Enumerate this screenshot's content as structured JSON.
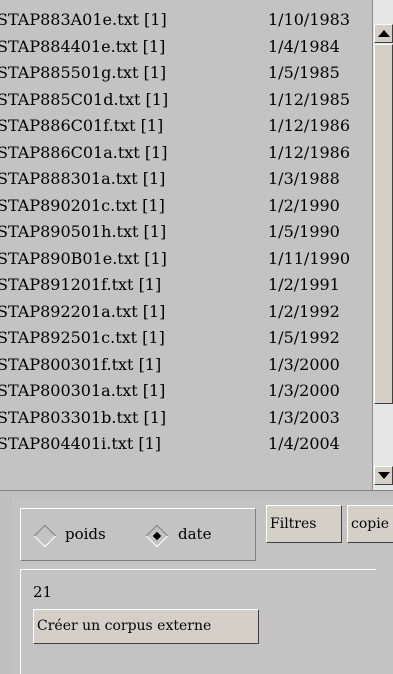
{
  "file_list": [
    {
      "name": "STAP883A01e.txt [1]",
      "date": "1/10/1983"
    },
    {
      "name": "STAP884401e.txt [1]",
      "date": "1/4/1984"
    },
    {
      "name": "STAP885501g.txt [1]",
      "date": "1/5/1985"
    },
    {
      "name": "STAP885C01d.txt [1]",
      "date": "1/12/1985"
    },
    {
      "name": "STAP886C01f.txt [1]",
      "date": "1/12/1986"
    },
    {
      "name": "STAP886C01a.txt [1]",
      "date": "1/12/1986"
    },
    {
      "name": "STAP888301a.txt [1]",
      "date": "1/3/1988"
    },
    {
      "name": "STAP890201c.txt [1]",
      "date": "1/2/1990"
    },
    {
      "name": "STAP890501h.txt [1]",
      "date": "1/5/1990"
    },
    {
      "name": "STAP890B01e.txt [1]",
      "date": "1/11/1990"
    },
    {
      "name": "STAP891201f.txt [1]",
      "date": "1/2/1991"
    },
    {
      "name": "STAP892201a.txt [1]",
      "date": "1/2/1992"
    },
    {
      "name": "STAP892501c.txt [1]",
      "date": "1/5/1992"
    },
    {
      "name": "STAP800301f.txt [1]",
      "date": "1/3/2000"
    },
    {
      "name": "STAP800301a.txt [1]",
      "date": "1/3/2000"
    },
    {
      "name": "STAP803301b.txt [1]",
      "date": "1/3/2003"
    },
    {
      "name": "STAP804401i.txt [1]",
      "date": "1/4/2004"
    }
  ],
  "sort_options": {
    "poids_label": "poids",
    "date_label": "date",
    "selected": "date"
  },
  "buttons": {
    "filtres": "Filtres",
    "copie": "copie",
    "creer_corpus": "Créer un corpus externe"
  },
  "count_value": "21"
}
